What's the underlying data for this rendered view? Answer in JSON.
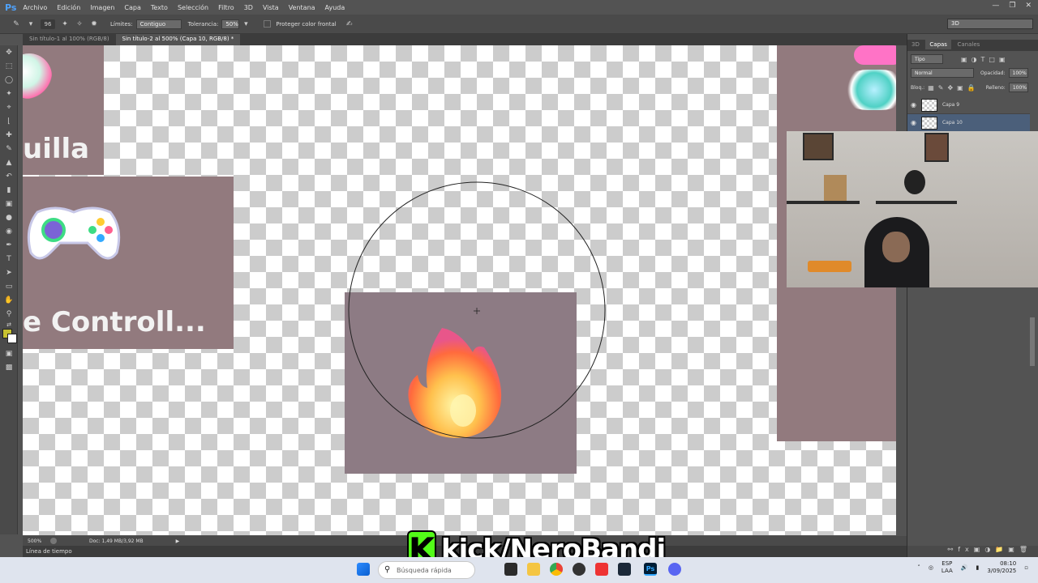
{
  "app": {
    "logo": "Ps"
  },
  "menu": [
    "Archivo",
    "Edición",
    "Imagen",
    "Capa",
    "Texto",
    "Selección",
    "Filtro",
    "3D",
    "Vista",
    "Ventana",
    "Ayuda"
  ],
  "options": {
    "brush_size": "96",
    "limits_label": "Límites:",
    "limits_value": "Contiguo",
    "tolerance_label": "Tolerancia:",
    "tolerance_value": "50%",
    "protect_label": "Proteger color frontal"
  },
  "workspace": "3D",
  "tabs": [
    {
      "label": "Sin título-1 al 100% (RGB/8)",
      "active": false
    },
    {
      "label": "Sin título-2 al 500% (Capa 10, RGB/8) *",
      "active": true
    }
  ],
  "canvas": {
    "text_top": "uilla",
    "text_bottom": "e Controll..."
  },
  "status": {
    "zoom": "500%",
    "doc": "Doc: 1,49 MB/3,92 MB"
  },
  "timeline_label": "Línea de tiempo",
  "panel": {
    "tabs": [
      "3D",
      "Capas",
      "Canales"
    ],
    "kind_filter": "Tipo",
    "blend_mode": "Normal",
    "opacity_label": "Opacidad:",
    "opacity_value": "100%",
    "lock_label": "Bloq.:",
    "fill_label": "Relleno:",
    "fill_value": "100%",
    "layers": [
      {
        "name": "Capa 9",
        "selected": false
      },
      {
        "name": "Capa 10",
        "selected": true
      }
    ]
  },
  "overlay": {
    "kick_letter": "K",
    "kick_text": "kick/NeroBandi"
  },
  "taskbar": {
    "search_placeholder": "Búsqueda rápida",
    "lang_top": "ESP",
    "lang_bottom": "LAA",
    "time": "08:10",
    "date": "3/09/2025"
  }
}
